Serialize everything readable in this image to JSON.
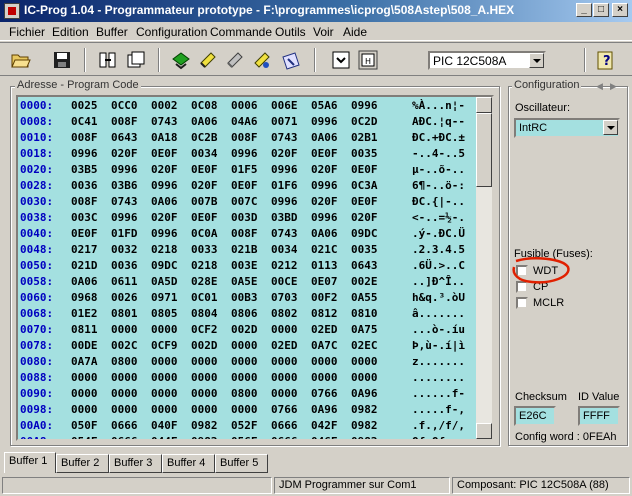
{
  "window": {
    "title": "IC-Prog 1.04 - Programmateur prototype - F:\\programmes\\icprog\\508Astep\\508_A.HEX"
  },
  "menu": [
    "Fichier",
    "Edition",
    "Buffer",
    "Configuration",
    "Commande",
    "Outils",
    "Voir",
    "Aide"
  ],
  "toolbar": {
    "device": "PIC 12C508A"
  },
  "code": {
    "group_title": "Adresse - Program Code",
    "rows": [
      {
        "addr": "0000:",
        "words": [
          "0025",
          "0CC0",
          "0002",
          "0C08",
          "0006",
          "006E",
          "05A6",
          "0996"
        ],
        "ascii": "%À...n¦-"
      },
      {
        "addr": "0008:",
        "words": [
          "0C41",
          "008F",
          "0743",
          "0A06",
          "04A6",
          "0071",
          "0996",
          "0C2D"
        ],
        "ascii": "AÐC.¦q--"
      },
      {
        "addr": "0010:",
        "words": [
          "008F",
          "0643",
          "0A18",
          "0C2B",
          "008F",
          "0743",
          "0A06",
          "02B1"
        ],
        "ascii": "ÐC.+ÐC.±"
      },
      {
        "addr": "0018:",
        "words": [
          "0996",
          "020F",
          "0E0F",
          "0034",
          "0996",
          "020F",
          "0E0F",
          "0035"
        ],
        "ascii": "-..4-..5"
      },
      {
        "addr": "0020:",
        "words": [
          "03B5",
          "0996",
          "020F",
          "0E0F",
          "01F5",
          "0996",
          "020F",
          "0E0F"
        ],
        "ascii": "µ-..õ-.."
      },
      {
        "addr": "0028:",
        "words": [
          "0036",
          "03B6",
          "0996",
          "020F",
          "0E0F",
          "01F6",
          "0996",
          "0C3A"
        ],
        "ascii": "6¶-..ö-:"
      },
      {
        "addr": "0030:",
        "words": [
          "008F",
          "0743",
          "0A06",
          "007B",
          "007C",
          "0996",
          "020F",
          "0E0F"
        ],
        "ascii": "ÐC.{|-.."
      },
      {
        "addr": "0038:",
        "words": [
          "003C",
          "0996",
          "020F",
          "0E0F",
          "003D",
          "03BD",
          "0996",
          "020F"
        ],
        "ascii": "<-..=½-."
      },
      {
        "addr": "0040:",
        "words": [
          "0E0F",
          "01FD",
          "0996",
          "0C0A",
          "008F",
          "0743",
          "0A06",
          "09DC"
        ],
        "ascii": ".ý-.ÐC.Ü"
      },
      {
        "addr": "0048:",
        "words": [
          "0217",
          "0032",
          "0218",
          "0033",
          "021B",
          "0034",
          "021C",
          "0035"
        ],
        "ascii": ".2.3.4.5"
      },
      {
        "addr": "0050:",
        "words": [
          "021D",
          "0036",
          "09DC",
          "0218",
          "003E",
          "0212",
          "0113",
          "0643"
        ],
        "ascii": ".6Ü.>..C"
      },
      {
        "addr": "0058:",
        "words": [
          "0A06",
          "0611",
          "0A5D",
          "028E",
          "0A5E",
          "00CE",
          "0E07",
          "002E"
        ],
        "ascii": "..]Ð^Î.."
      },
      {
        "addr": "0060:",
        "words": [
          "0968",
          "0026",
          "0971",
          "0C01",
          "00B3",
          "0703",
          "00F2",
          "0A55"
        ],
        "ascii": "h&q.³.òU"
      },
      {
        "addr": "0068:",
        "words": [
          "01E2",
          "0801",
          "0805",
          "0804",
          "0806",
          "0802",
          "0812",
          "0810"
        ],
        "ascii": "â......."
      },
      {
        "addr": "0070:",
        "words": [
          "0811",
          "0000",
          "0000",
          "0CF2",
          "002D",
          "0000",
          "02ED",
          "0A75"
        ],
        "ascii": "...ò-.íu"
      },
      {
        "addr": "0078:",
        "words": [
          "00DE",
          "002C",
          "0CF9",
          "002D",
          "0000",
          "02ED",
          "0A7C",
          "02EC"
        ],
        "ascii": "Þ,ù-.í|ì"
      },
      {
        "addr": "0080:",
        "words": [
          "0A7A",
          "0800",
          "0000",
          "0000",
          "0000",
          "0000",
          "0000",
          "0000"
        ],
        "ascii": "z......."
      },
      {
        "addr": "0088:",
        "words": [
          "0000",
          "0000",
          "0000",
          "0000",
          "0000",
          "0000",
          "0000",
          "0000"
        ],
        "ascii": "........"
      },
      {
        "addr": "0090:",
        "words": [
          "0000",
          "0000",
          "0000",
          "0000",
          "0800",
          "0000",
          "0766",
          "0A96"
        ],
        "ascii": "......f-"
      },
      {
        "addr": "0098:",
        "words": [
          "0000",
          "0000",
          "0000",
          "0000",
          "0000",
          "0766",
          "0A96",
          "0982"
        ],
        "ascii": ".....f-,"
      },
      {
        "addr": "00A0:",
        "words": [
          "050F",
          "0666",
          "040F",
          "0982",
          "052F",
          "0666",
          "042F",
          "0982"
        ],
        "ascii": ".f.,/f/,"
      },
      {
        "addr": "00A8:",
        "words": [
          "054F",
          "0666",
          "044F",
          "0982",
          "056F",
          "0666",
          "046F",
          "0982"
        ],
        "ascii": "Of.Of.o,"
      }
    ]
  },
  "config": {
    "group_title": "Configuration",
    "osc_label": "Oscillateur:",
    "osc_value": "IntRC",
    "fuses_label": "Fusible (Fuses):",
    "fuses": [
      "WDT",
      "CP",
      "MCLR"
    ],
    "checksum_label": "Checksum",
    "checksum_value": "E26C",
    "id_label": "ID Value",
    "id_value": "FFFF",
    "config_word": "Config word : 0FEAh"
  },
  "tabs": [
    "Buffer 1",
    "Buffer 2",
    "Buffer 3",
    "Buffer 4",
    "Buffer 5"
  ],
  "status": {
    "programmer": "JDM Programmer sur Com1",
    "component": "Composant: PIC 12C508A  (88)"
  },
  "colors": {
    "code_bg": "#a4e0e0",
    "address": "#0000c0",
    "annotation": "#e02000"
  }
}
